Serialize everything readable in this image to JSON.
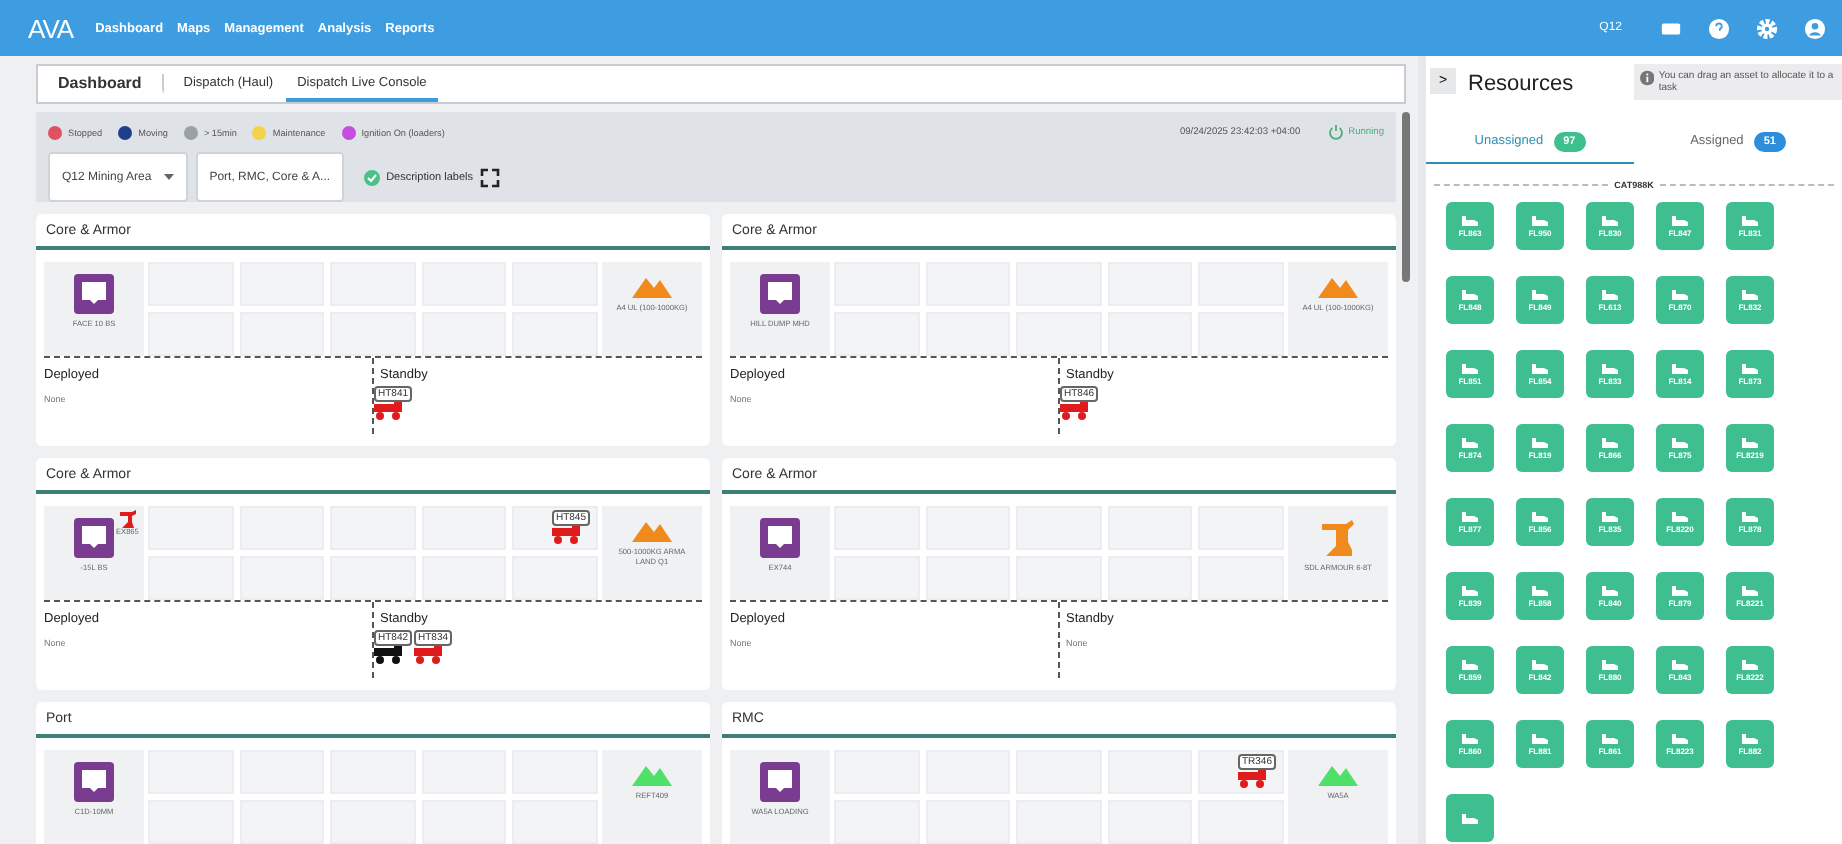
{
  "topbar": {
    "logo": "AVA",
    "nav": [
      "Dashboard",
      "Maps",
      "Management",
      "Analysis",
      "Reports"
    ],
    "site": "Q12"
  },
  "tabs": [
    {
      "label": "Dashboard",
      "selected": false
    },
    {
      "label": "Dispatch (Haul)",
      "selected": false
    },
    {
      "label": "Dispatch Live Console",
      "selected": true
    }
  ],
  "legend": [
    {
      "label": "Stopped",
      "color": "#e0525f"
    },
    {
      "label": "Moving",
      "color": "#1f3f8a"
    },
    {
      "label": "> 15min",
      "color": "#9aa0a8"
    },
    {
      "label": "Maintenance",
      "color": "#f3d34a"
    },
    {
      "label": "Ignition On (loaders)",
      "color": "#c64be0"
    }
  ],
  "timestamp": "09/24/2025 23:42:03 +04:00",
  "status": "Running",
  "filters": {
    "area": "Q12 Mining Area",
    "groups": "Port, RMC, Core & A...",
    "description_labels": {
      "label": "Description labels",
      "checked": true
    }
  },
  "cards": [
    {
      "title": "Core & Armor",
      "source": "FACE 10 BS",
      "destination": {
        "kind": "stockpile",
        "color": "#f08a1c",
        "label": "A4 UL (100-1000KG)"
      },
      "deployed_heading": "Deployed",
      "deployed": "None",
      "standby_heading": "Standby",
      "standby": [
        {
          "id": "HT841",
          "color": "#e01b1b"
        }
      ]
    },
    {
      "title": "Core & Armor",
      "source": "HILL DUMP MHD",
      "destination": {
        "kind": "stockpile",
        "color": "#f08a1c",
        "label": "A4 UL (100-1000KG)"
      },
      "deployed_heading": "Deployed",
      "deployed": "None",
      "standby_heading": "Standby",
      "standby": [
        {
          "id": "HT846",
          "color": "#e01b1b"
        }
      ]
    },
    {
      "title": "Core & Armor",
      "source": "-15L BS",
      "loader": {
        "id": "EX865",
        "color": "#e01b1b"
      },
      "grid_vehicles": [
        {
          "id": "HT845",
          "color": "#e01b1b"
        }
      ],
      "destination": {
        "kind": "stockpile",
        "color": "#f08a1c",
        "label": "500-1000KG ARMA LAND Q1"
      },
      "deployed_heading": "Deployed",
      "deployed": "None",
      "standby_heading": "Standby",
      "standby": [
        {
          "id": "HT842",
          "color": "#111111"
        },
        {
          "id": "HT834",
          "color": "#e01b1b"
        }
      ]
    },
    {
      "title": "Core & Armor",
      "source": "EX744",
      "destination": {
        "kind": "excavator",
        "color": "#f08a1c",
        "label": "SDL ARMOUR 6-8T"
      },
      "deployed_heading": "Deployed",
      "deployed": "None",
      "standby_heading": "Standby",
      "standby_text": "None"
    },
    {
      "title": "Port",
      "source": "C1D-10MM",
      "destination": {
        "kind": "stockpile",
        "color": "#4fe06a",
        "label": "REFT409"
      }
    },
    {
      "title": "RMC",
      "source": "WA5A LOADING",
      "grid_vehicles": [
        {
          "id": "TR346",
          "color": "#e01b1b"
        }
      ],
      "destination": {
        "kind": "stockpile",
        "color": "#4fe06a",
        "label": "WA5A"
      }
    }
  ],
  "resources": {
    "title": "Resources",
    "toggle": ">",
    "hint": "You can drag an asset to allocate it to a task",
    "tabs": [
      {
        "label": "Unassigned",
        "count": "97",
        "selected": true,
        "color": "#3dbf8e"
      },
      {
        "label": "Assigned",
        "count": "51",
        "selected": false,
        "color": "#2d8fdc"
      }
    ],
    "group": "CAT988K",
    "assets": [
      "FL863",
      "FL950",
      "FL830",
      "FL847",
      "FL831",
      "FL848",
      "FL849",
      "FL613",
      "FL870",
      "FL832",
      "FL851",
      "FL854",
      "FL833",
      "FL814",
      "FL873",
      "FL874",
      "FL819",
      "FL866",
      "FL875",
      "FL8219",
      "FL877",
      "FL856",
      "FL835",
      "FL8220",
      "FL878",
      "FL839",
      "FL858",
      "FL840",
      "FL879",
      "FL8221",
      "FL859",
      "FL842",
      "FL880",
      "FL843",
      "FL8222",
      "FL860",
      "FL881",
      "FL861",
      "FL8223",
      "FL882"
    ],
    "more_below": true
  }
}
